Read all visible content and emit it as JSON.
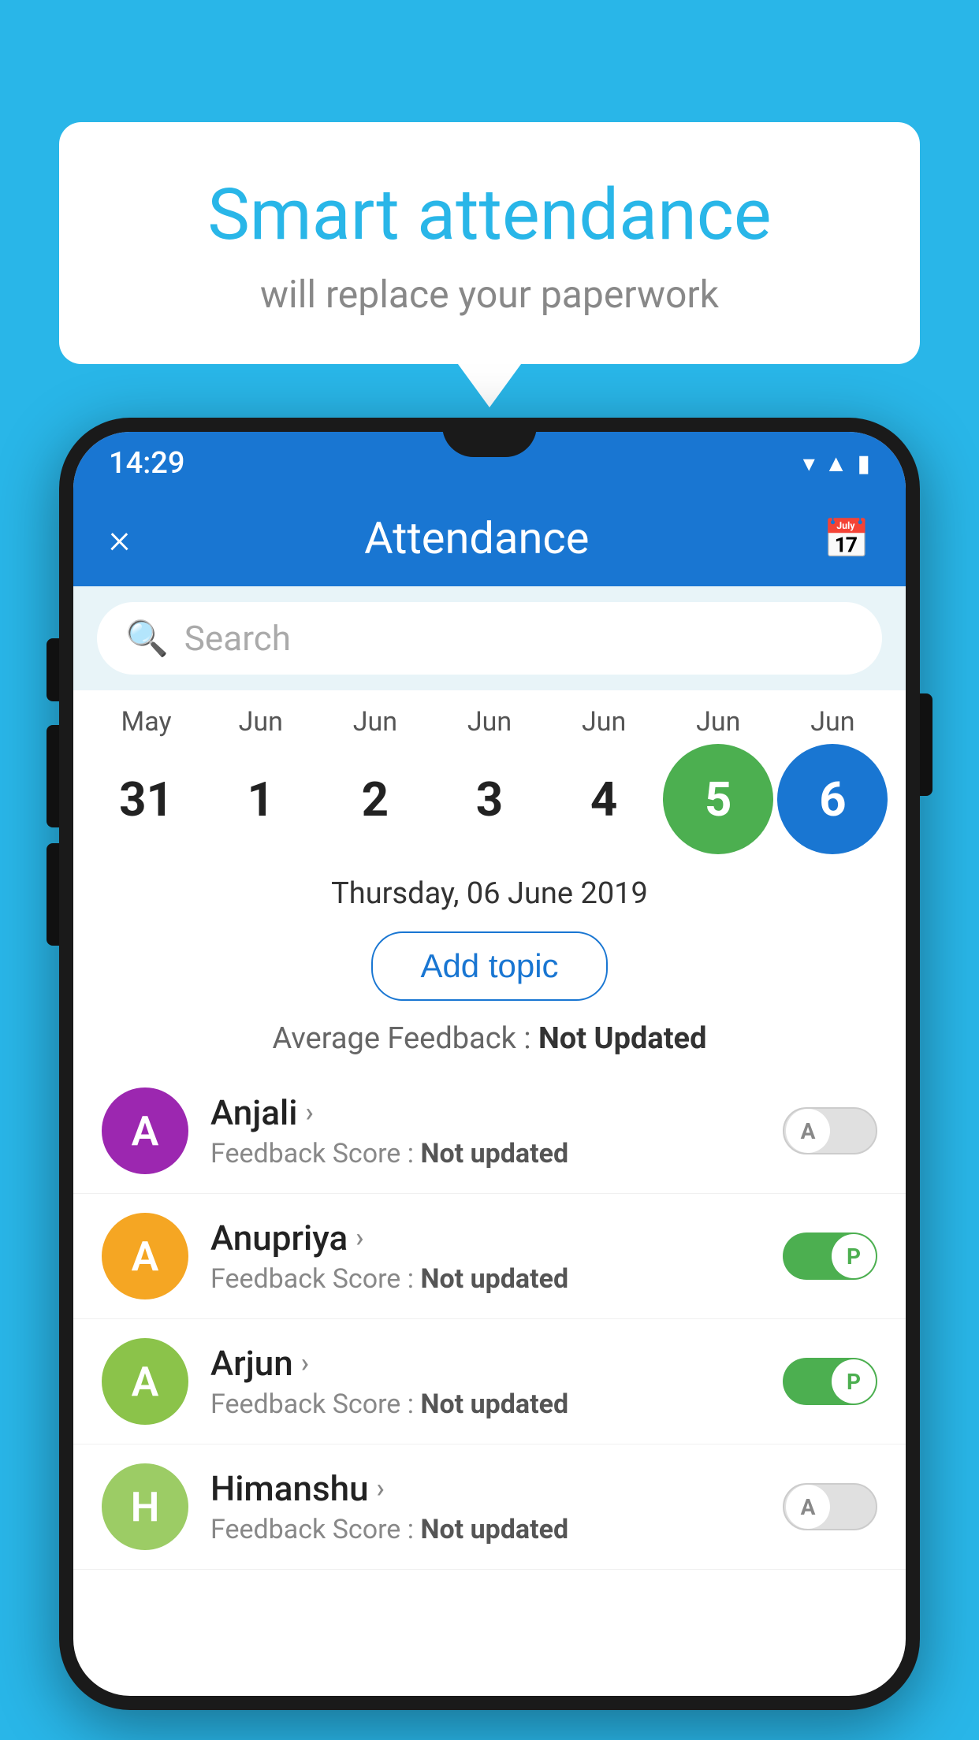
{
  "background_color": "#29b6e8",
  "speech_bubble": {
    "title": "Smart attendance",
    "subtitle": "will replace your paperwork"
  },
  "status_bar": {
    "time": "14:29",
    "icons": [
      "wifi",
      "signal",
      "battery"
    ]
  },
  "app_header": {
    "close_label": "×",
    "title": "Attendance",
    "calendar_icon": "📅"
  },
  "search": {
    "placeholder": "Search"
  },
  "calendar": {
    "months": [
      "May",
      "Jun",
      "Jun",
      "Jun",
      "Jun",
      "Jun",
      "Jun"
    ],
    "dates": [
      "31",
      "1",
      "2",
      "3",
      "4",
      "5",
      "6"
    ],
    "today_index": 5,
    "selected_index": 6
  },
  "selected_date": "Thursday, 06 June 2019",
  "add_topic_label": "Add topic",
  "average_feedback": {
    "label": "Average Feedback : ",
    "value": "Not Updated"
  },
  "students": [
    {
      "name": "Anjali",
      "avatar_letter": "A",
      "avatar_color": "#9c27b0",
      "feedback_label": "Feedback Score : ",
      "feedback_value": "Not updated",
      "toggle_state": "off",
      "toggle_letter": "A"
    },
    {
      "name": "Anupriya",
      "avatar_letter": "A",
      "avatar_color": "#f5a623",
      "feedback_label": "Feedback Score : ",
      "feedback_value": "Not updated",
      "toggle_state": "on",
      "toggle_letter": "P"
    },
    {
      "name": "Arjun",
      "avatar_letter": "A",
      "avatar_color": "#8bc34a",
      "feedback_label": "Feedback Score : ",
      "feedback_value": "Not updated",
      "toggle_state": "on",
      "toggle_letter": "P"
    },
    {
      "name": "Himanshu",
      "avatar_letter": "H",
      "avatar_color": "#9ccc65",
      "feedback_label": "Feedback Score : ",
      "feedback_value": "Not updated",
      "toggle_state": "off",
      "toggle_letter": "A"
    }
  ]
}
